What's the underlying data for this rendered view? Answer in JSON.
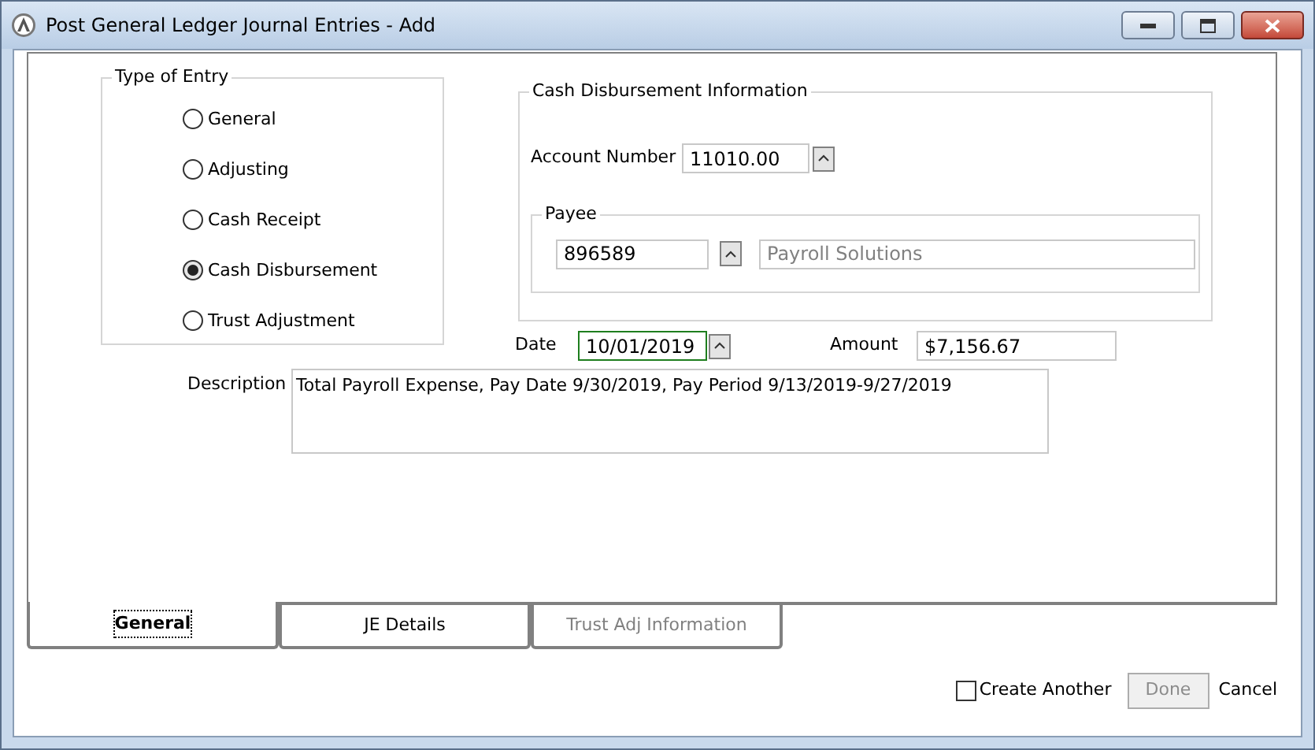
{
  "window": {
    "title": "Post General Ledger Journal Entries - Add"
  },
  "type_of_entry": {
    "label": "Type of Entry",
    "options": [
      {
        "label": "General",
        "selected": false
      },
      {
        "label": "Adjusting",
        "selected": false
      },
      {
        "label": "Cash Receipt",
        "selected": false
      },
      {
        "label": "Cash Disbursement",
        "selected": true
      },
      {
        "label": "Trust Adjustment",
        "selected": false
      }
    ]
  },
  "cash_disbursement": {
    "label": "Cash Disbursement Information",
    "account_number": {
      "label": "Account Number",
      "value": "11010.00"
    },
    "payee": {
      "label": "Payee",
      "number": "896589",
      "name": "Payroll Solutions"
    }
  },
  "date": {
    "label": "Date",
    "value": "10/01/2019",
    "focused": true
  },
  "amount": {
    "label": "Amount",
    "value": "$7,156.67"
  },
  "description": {
    "label": "Description",
    "value": "Total Payroll Expense, Pay Date 9/30/2019, Pay Period 9/13/2019-9/27/2019"
  },
  "tabs": [
    {
      "label": "General",
      "selected": true,
      "disabled": false
    },
    {
      "label": "JE Details",
      "selected": false,
      "disabled": false
    },
    {
      "label": "Trust Adj Information",
      "selected": false,
      "disabled": true
    }
  ],
  "create_another": {
    "label": "Create Another",
    "checked": false
  },
  "buttons": [
    {
      "label": "Done",
      "kind": "button",
      "disabled": true
    },
    {
      "label": "Cancel",
      "kind": "link",
      "disabled": false
    }
  ]
}
